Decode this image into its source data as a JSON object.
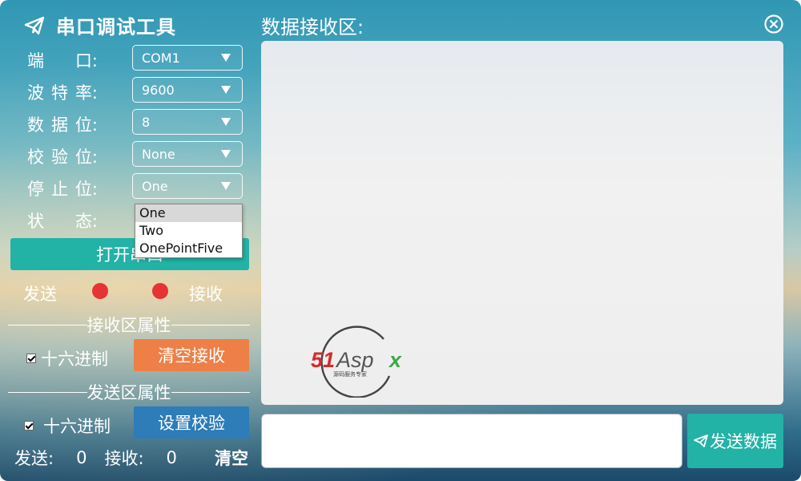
{
  "app": {
    "title": "串口调试工具"
  },
  "settings": {
    "port": {
      "label_chars": [
        "端",
        "口:"
      ],
      "value": "COM1"
    },
    "baud": {
      "label_chars": [
        "波",
        "特",
        "率:"
      ],
      "value": "9600"
    },
    "databits": {
      "label_chars": [
        "数",
        "据",
        "位:"
      ],
      "value": "8"
    },
    "parity": {
      "label_chars": [
        "校",
        "验",
        "位:"
      ],
      "value": "None"
    },
    "stopbits": {
      "label_chars": [
        "停",
        "止",
        "位:"
      ],
      "value": "One"
    },
    "status": {
      "label_chars": [
        "状",
        "态:"
      ]
    }
  },
  "stopbits_dropdown": {
    "options": [
      "One",
      "Two",
      "OnePointFive"
    ],
    "selected": "One"
  },
  "open_button": {
    "label": "打开串口"
  },
  "indicators": {
    "send_label": "发送",
    "recv_label": "接收",
    "color": "#e53434"
  },
  "recv_props": {
    "section_title": "接收区属性",
    "hex_label": "十六进制",
    "hex_checked": true,
    "clear_button": "清空接收"
  },
  "send_props": {
    "section_title": "发送区属性",
    "hex_label": "十六进制",
    "hex_checked": true,
    "checksum_button": "设置校验"
  },
  "stats": {
    "send_label": "发送:",
    "send_count": "0",
    "recv_label": "接收:",
    "recv_count": "0",
    "clear_label": "清空"
  },
  "receive_area": {
    "title": "数据接收区:"
  },
  "send_area": {
    "input_value": "",
    "send_button": "发送数据"
  },
  "watermark": {
    "brand": "51Aspx",
    "tagline": "源码服务专家"
  },
  "colors": {
    "accent_teal": "#22b2a6",
    "orange": "#ee7f47",
    "blue": "#2e7cb8",
    "led_red": "#e53434"
  }
}
